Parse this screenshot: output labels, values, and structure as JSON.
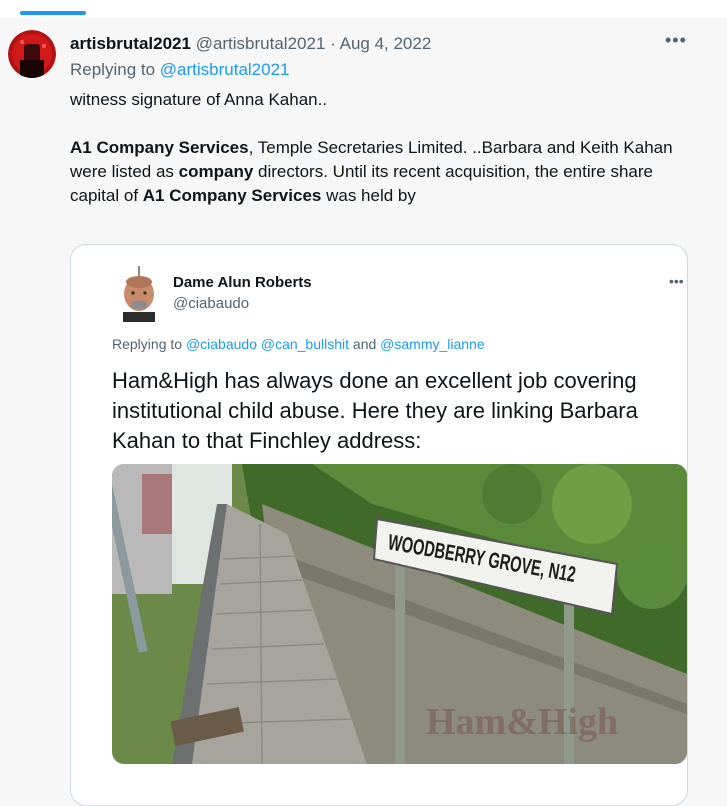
{
  "tweet": {
    "display_name": "artisbrutal2021",
    "handle": "@artisbrutal2021",
    "separator": "·",
    "date": "Aug 4, 2022",
    "more_icon": "more-horizontal-icon",
    "replying_prefix": "Replying to ",
    "replying_handle": "@artisbrutal2021",
    "line1": "witness signature of Anna Kahan..",
    "para": {
      "s1": "A1 Company Services",
      "s2": ", Temple Secretaries Limited. ..Barbara and Keith Kahan were listed as ",
      "s3": "company",
      "s4": " directors. Until its recent acquisition, the entire share capital of ",
      "s5": "A1 Company Services",
      "s6": " was held by"
    }
  },
  "quoted": {
    "display_name": "Dame Alun Roberts",
    "handle": "@ciabaudo",
    "replying_prefix": "Replying to ",
    "replying_handles": "@ciabaudo @can_bullshit",
    "replying_and": " and ",
    "replying_last": "@sammy_lianne",
    "text": "Ham&High has always done an excellent job covering institutional child abuse. Here they are linking Barbara Kahan to that Finchley address:",
    "image": {
      "sign_text": "WOODBERRY GROVE, N12",
      "watermark": "Ham&High"
    }
  },
  "colors": {
    "accent": "#1d9bf0",
    "text": "#0f1419",
    "muted": "#536471"
  }
}
